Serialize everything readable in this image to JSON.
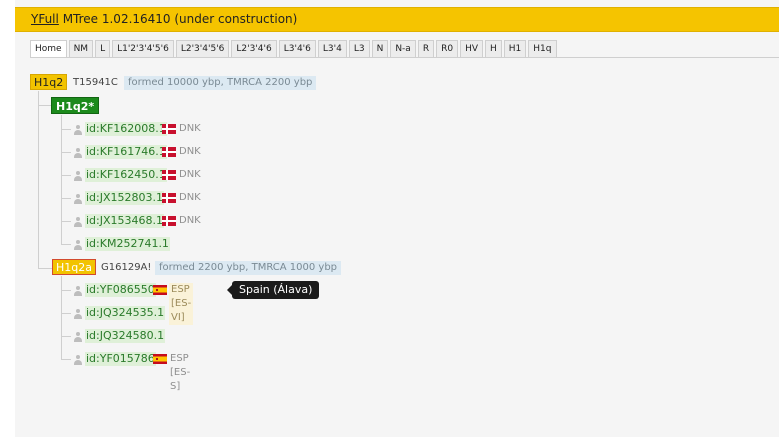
{
  "header": {
    "link": "YFull",
    "title": "MTree 1.02.16410 (under construction)"
  },
  "tabs": [
    "Home",
    "NM",
    "L",
    "L1'2'3'4'5'6",
    "L2'3'4'5'6",
    "L2'3'4'6",
    "L3'4'6",
    "L3'4",
    "L3",
    "N",
    "N-a",
    "R",
    "R0",
    "HV",
    "H",
    "H1",
    "H1q"
  ],
  "root": {
    "name": "H1q2",
    "snp": "T15941C",
    "age": "formed 10000 ybp, TMRCA 2200 ybp"
  },
  "h1q2star": {
    "name": "H1q2*"
  },
  "h1q2star_samples": [
    {
      "id": "id:KF162008.1",
      "flag": "dk",
      "country": "DNK"
    },
    {
      "id": "id:KF161746.1",
      "flag": "dk",
      "country": "DNK"
    },
    {
      "id": "id:KF162450.1",
      "flag": "dk",
      "country": "DNK"
    },
    {
      "id": "id:JX152803.1",
      "flag": "dk",
      "country": "DNK"
    },
    {
      "id": "id:JX153468.1",
      "flag": "dk",
      "country": "DNK"
    },
    {
      "id": "id:KM252741.1",
      "flag": "",
      "country": ""
    }
  ],
  "h1q2a": {
    "name": "H1q2a",
    "snp": "G16129A!",
    "age": "formed 2200 ybp, TMRCA 1000 ybp"
  },
  "h1q2a_samples": [
    {
      "id": "id:YF086550",
      "flag": "es",
      "country": "ESP [ES-VI]",
      "highlight": true
    },
    {
      "id": "id:JQ324535.1",
      "flag": "",
      "country": ""
    },
    {
      "id": "id:JQ324580.1",
      "flag": "",
      "country": ""
    },
    {
      "id": "id:YF015786",
      "flag": "es",
      "country": "ESP [ES-S]"
    }
  ],
  "tooltip": "Spain (Álava)"
}
